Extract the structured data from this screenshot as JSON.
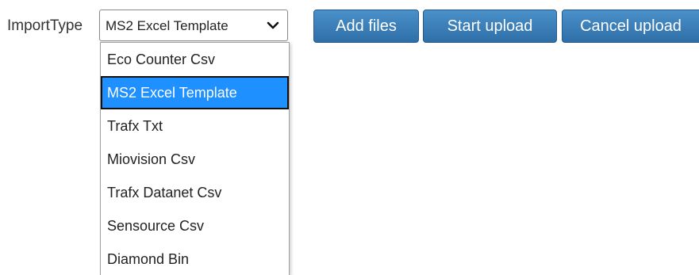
{
  "form": {
    "import_label": "ImportType",
    "selected_value": "MS2 Excel Template"
  },
  "buttons": {
    "add_files": "Add files",
    "start_upload": "Start upload",
    "cancel_upload": "Cancel upload"
  },
  "dropdown": {
    "options": [
      "Eco Counter Csv",
      "MS2 Excel Template",
      "Trafx Txt",
      "Miovision Csv",
      "Trafx Datanet Csv",
      "Sensource Csv",
      "Diamond Bin"
    ],
    "selected_index": 1
  },
  "colors": {
    "button_background": "#337ab7",
    "highlight": "#1e90ff",
    "text": "#333333"
  },
  "icons": {
    "select_arrow": "chevron-down-icon"
  }
}
